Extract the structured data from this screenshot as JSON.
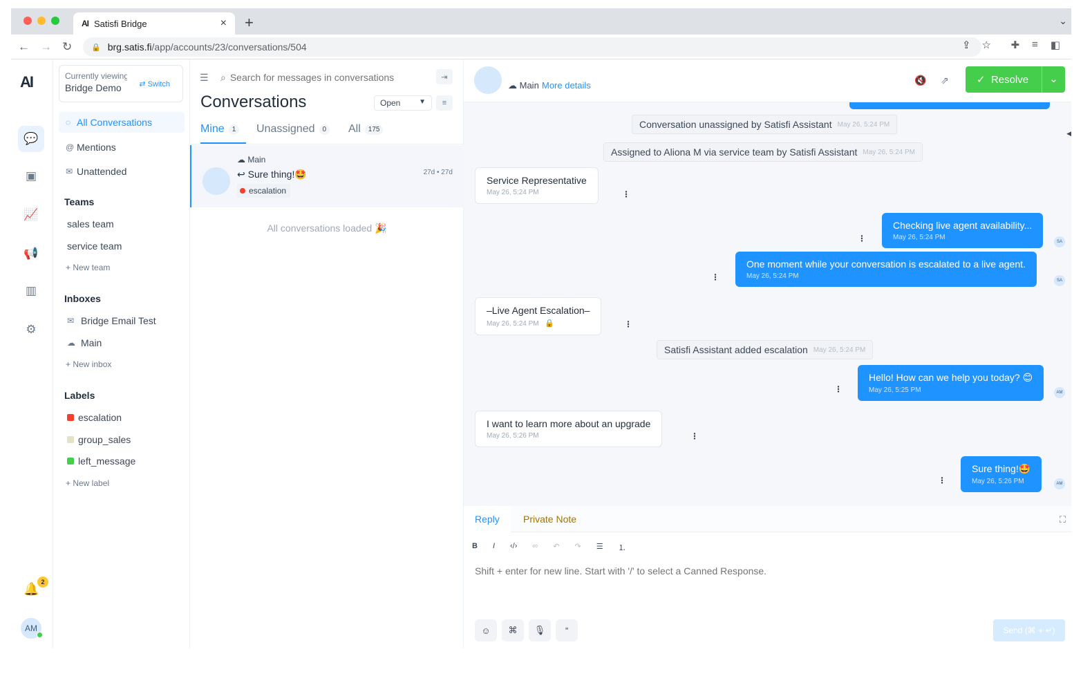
{
  "browser": {
    "tab_title": "Satisfi Bridge",
    "tab_favicon": "AI",
    "url_host": "brg.satis.fi",
    "url_path": "/app/accounts/23/conversations/504",
    "traffic_colors": [
      "#ff5f57",
      "#febc2e",
      "#28c840"
    ]
  },
  "rail": {
    "logo": "AI",
    "notification_count": "2",
    "user_initials": "AM"
  },
  "sidebar": {
    "switcher_caption": "Currently viewing",
    "switcher_account": "Bridge Demo",
    "switch_label": "Switch",
    "menu": [
      {
        "label": "All Conversations",
        "icon": "chat-icon"
      },
      {
        "label": "Mentions",
        "icon": "at-icon"
      },
      {
        "label": "Unattended",
        "icon": "inbox-icon"
      }
    ],
    "teams_title": "Teams",
    "teams": [
      "sales team",
      "service team"
    ],
    "new_team": "New team",
    "inboxes_title": "Inboxes",
    "inboxes": [
      {
        "label": "Bridge Email Test",
        "icon": "email-icon"
      },
      {
        "label": "Main",
        "icon": "cloud-icon"
      }
    ],
    "new_inbox": "New inbox",
    "labels_title": "Labels",
    "labels": [
      {
        "label": "escalation",
        "color": "#f4402c"
      },
      {
        "label": "group_sales",
        "color": "#e3e3c7"
      },
      {
        "label": "left_message",
        "color": "#44ce4b"
      }
    ],
    "new_label": "New label"
  },
  "conversations": {
    "search_placeholder": "Search for messages in conversations",
    "title": "Conversations",
    "status": "Open",
    "tabs": [
      {
        "label": "Mine",
        "count": "1"
      },
      {
        "label": "Unassigned",
        "count": "0"
      },
      {
        "label": "All",
        "count": "175"
      }
    ],
    "card": {
      "inbox": "Main",
      "message": "Sure thing!🤩",
      "time": "27d • 27d",
      "label": "escalation"
    },
    "loaded_text": "All conversations loaded 🎉"
  },
  "chat": {
    "inbox": "Main",
    "more_details": "More details",
    "resolve_label": "Resolve",
    "activities": [
      {
        "text": "Conversation unassigned by Satisfi Assistant",
        "time": "May 26, 5:24 PM"
      },
      {
        "text": "Assigned to Aliona M via service team by Satisfi Assistant",
        "time": "May 26, 5:24 PM"
      },
      {
        "text": "Satisfi Assistant added escalation",
        "time": "May 26, 5:24 PM"
      }
    ],
    "incoming": [
      {
        "text": "Service Representative",
        "time": "May 26, 5:24 PM"
      },
      {
        "text": "–Live Agent Escalation–",
        "time": "May 26, 5:24 PM"
      },
      {
        "text": "I want to learn more about an upgrade",
        "time": "May 26, 5:26 PM"
      }
    ],
    "outgoing": [
      {
        "text": "Checking live agent availability...",
        "time": "May 26, 5:24 PM",
        "avatar": "SA"
      },
      {
        "text": "One moment while your conversation is escalated to a live agent.",
        "time": "May 26, 5:24 PM",
        "avatar": "SA"
      },
      {
        "text": "Hello! How can we help you today? 😊",
        "time": "May 26, 5:25 PM",
        "avatar": "AM"
      },
      {
        "text": "Sure thing!🤩",
        "time": "May 26, 5:26 PM",
        "avatar": "AM"
      }
    ],
    "reply_tab": "Reply",
    "note_tab": "Private Note",
    "composer_placeholder": "Shift + enter for new line. Start with '/' to select a Canned Response.",
    "send_label": "Send (⌘ + ↵)"
  },
  "colors": {
    "accent": "#1f93ff",
    "resolve": "#44ce4b"
  }
}
